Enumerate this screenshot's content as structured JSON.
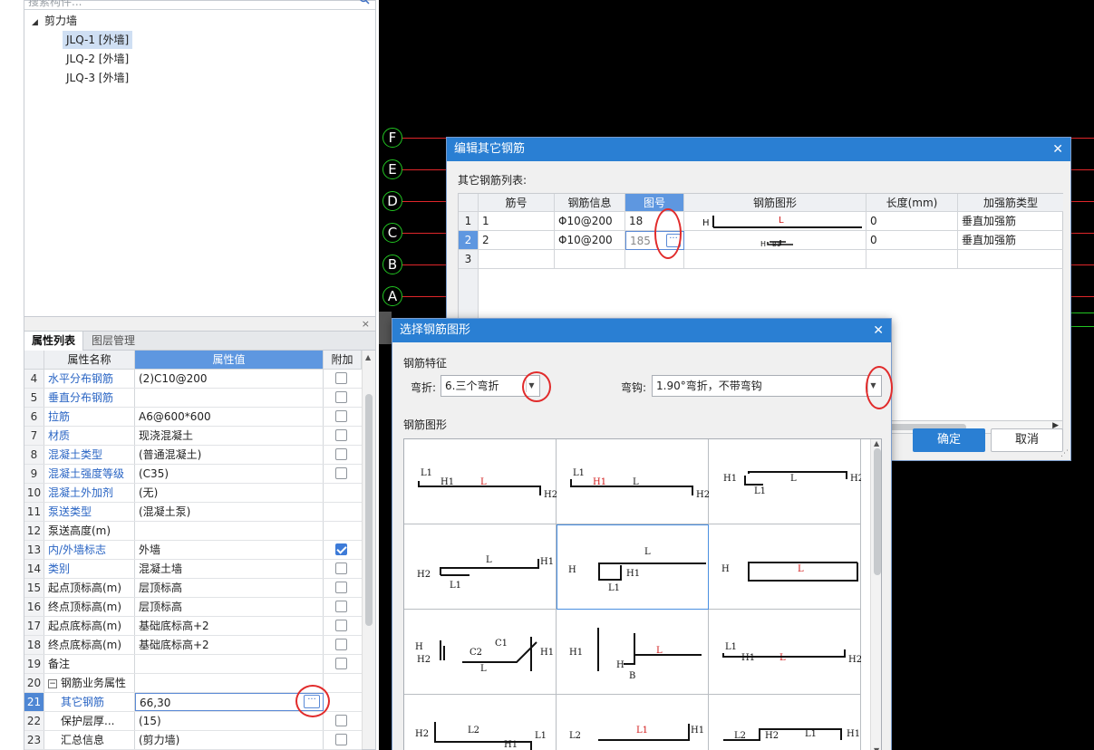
{
  "tree": {
    "search_placeholder": "搜索构件...",
    "root_label": "剪力墙",
    "items": [
      "JLQ-1 [外墙]",
      "JLQ-2 [外墙]",
      "JLQ-3 [外墙]"
    ]
  },
  "panel": {
    "tabs": [
      "属性列表",
      "图层管理"
    ],
    "headers": {
      "name": "属性名称",
      "value": "属性值",
      "extra": "附加"
    },
    "rows": [
      {
        "num": "4",
        "name": "水平分布钢筋",
        "value": "(2)C10@200",
        "checked": false,
        "blue": true
      },
      {
        "num": "5",
        "name": "垂直分布钢筋",
        "value": "",
        "checked": false,
        "blue": true
      },
      {
        "num": "6",
        "name": "拉筋",
        "value": "A6@600*600",
        "checked": false,
        "blue": true
      },
      {
        "num": "7",
        "name": "材质",
        "value": "现浇混凝土",
        "checked": false,
        "blue": true
      },
      {
        "num": "8",
        "name": "混凝土类型",
        "value": "(普通混凝土)",
        "checked": false,
        "blue": true
      },
      {
        "num": "9",
        "name": "混凝土强度等级",
        "value": "(C35)",
        "checked": false,
        "blue": true
      },
      {
        "num": "10",
        "name": "混凝土外加剂",
        "value": "(无)",
        "checked": null,
        "blue": true
      },
      {
        "num": "11",
        "name": "泵送类型",
        "value": "(混凝土泵)",
        "checked": null,
        "blue": true
      },
      {
        "num": "12",
        "name": "泵送高度(m)",
        "value": "",
        "checked": null,
        "blue": false
      },
      {
        "num": "13",
        "name": "内/外墙标志",
        "value": "外墙",
        "checked": true,
        "blue": true
      },
      {
        "num": "14",
        "name": "类别",
        "value": "混凝土墙",
        "checked": false,
        "blue": true
      },
      {
        "num": "15",
        "name": "起点顶标高(m)",
        "value": "层顶标高",
        "checked": false,
        "blue": false
      },
      {
        "num": "16",
        "name": "终点顶标高(m)",
        "value": "层顶标高",
        "checked": false,
        "blue": false
      },
      {
        "num": "17",
        "name": "起点底标高(m)",
        "value": "基础底标高+2",
        "checked": false,
        "blue": false
      },
      {
        "num": "18",
        "name": "终点底标高(m)",
        "value": "基础底标高+2",
        "checked": false,
        "blue": false
      },
      {
        "num": "19",
        "name": "备注",
        "value": "",
        "checked": false,
        "blue": false
      },
      {
        "num": "20",
        "name": "钢筋业务属性",
        "value": "",
        "checked": null,
        "blue": false,
        "group": true
      },
      {
        "num": "21",
        "name": "其它钢筋",
        "value": "66,30",
        "checked": null,
        "blue": true,
        "child": true,
        "selected": true
      },
      {
        "num": "22",
        "name": "保护层厚...",
        "value": "(15)",
        "checked": false,
        "blue": false,
        "child": true
      },
      {
        "num": "23",
        "name": "汇总信息",
        "value": "(剪力墙)",
        "checked": false,
        "blue": false,
        "child": true
      }
    ],
    "group_toggle": "−"
  },
  "cad": {
    "axes": [
      "F",
      "E",
      "D",
      "C",
      "B",
      "A"
    ],
    "circle_color": "#22c622",
    "line_color": "#e0262a"
  },
  "dialog_other_rebar": {
    "title": "编辑其它钢筋",
    "list_label": "其它钢筋列表:",
    "columns": [
      "筋号",
      "钢筋信息",
      "图号",
      "钢筋图形",
      "长度(mm)",
      "加强筋类型"
    ],
    "rows": [
      {
        "rn": "1",
        "bar_no": "1",
        "info": "Φ10@200",
        "fig": "18",
        "len": "0",
        "type": "垂直加强筋"
      },
      {
        "rn": "2",
        "bar_no": "2",
        "info": "Φ10@200",
        "fig": "185",
        "len": "0",
        "type": "垂直加强筋"
      },
      {
        "rn": "3",
        "bar_no": "",
        "info": "",
        "fig": "",
        "len": "",
        "type": ""
      }
    ],
    "ok": "确定",
    "cancel": "取消"
  },
  "dialog_shape": {
    "title": "选择钢筋图形",
    "feature_label": "钢筋特征",
    "bend_label": "弯折:",
    "bend_value": "6.三个弯折",
    "hook_label": "弯钩:",
    "hook_value": "1.90°弯折，不带弯钩",
    "shape_label": "钢筋图形"
  }
}
